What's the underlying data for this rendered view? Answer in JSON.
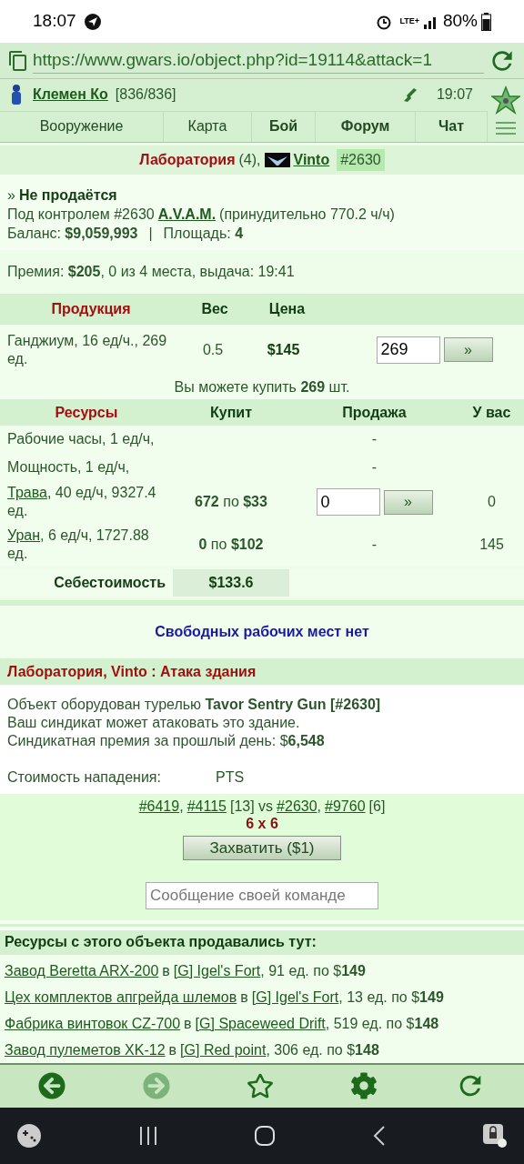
{
  "status_bar": {
    "time": "18:07",
    "network": "LTE+",
    "battery": "80%"
  },
  "address_bar": {
    "url": "https://www.gwars.io/object.php?id=19114&attack=1"
  },
  "player": {
    "name": "Клемен Ко",
    "hp": "[836/836]",
    "time": "19:07"
  },
  "nav": [
    {
      "label": "Вооружение",
      "bold": false
    },
    {
      "label": "Карта",
      "bold": false
    },
    {
      "label": "Бой",
      "bold": true
    },
    {
      "label": "Форум",
      "bold": true
    },
    {
      "label": "Чат",
      "bold": true
    }
  ],
  "title": {
    "name": "Лаборатория",
    "count": "(4),",
    "owner": "Vinto",
    "id": "#2630"
  },
  "info": {
    "marker": "»",
    "status": "Не продаётся",
    "control": "Под контролем #2630",
    "control_link": "A.V.A.M.",
    "control_note": "(принудительно 770.2 ч/ч)",
    "balance": "Баланс: **$9,059,993**",
    "separator": "|",
    "area": "Площадь: **4**",
    "premium": "Премия: **$205**, 0 из 4 места, выдача: 19:41"
  },
  "production": {
    "columns": [
      "Продукция",
      "Вес",
      "Цена"
    ],
    "rows": [
      {
        "name": "Ганджиум, 16 ед/ч., 269 ед.",
        "weight": "0.5",
        "price": "$145",
        "quantity": "269",
        "button": "»"
      }
    ],
    "note": "Вы можете купить **269** шт."
  },
  "resources": {
    "columns": [
      "Ресурсы",
      "Купит",
      "Продажа",
      "У вас"
    ],
    "rows": [
      {
        "kind": "plain",
        "name": "Рабочие часы, 1 ед/ч,",
        "sale": "-"
      },
      {
        "kind": "plain",
        "name": "Мощность, 1 ед/ч,",
        "sale": "-"
      },
      {
        "kind": "input",
        "link": "Трава",
        "name": ", 40 ед/ч, 9327.4 ед.",
        "buys": "**672** по **$33**",
        "quantity": "0",
        "button": "»",
        "have": "0"
      },
      {
        "kind": "plain",
        "link": "Уран",
        "name": ", 6 ед/ч, 1727.88 ед.",
        "buys": "**0** по **$102**",
        "sale": "-",
        "have": "145"
      }
    ],
    "cost_label": "Себестоимость",
    "cost_value": "$133.6"
  },
  "no_jobs": "Свободных рабочих мест нет",
  "attack": {
    "header": "Лаборатория, Vinto : Атака здания",
    "lines": [
      "Объект оборудован турелью **Tavor Sentry Gun [#2630]**",
      "Ваш синдикат может атаковать это здание.",
      "Синдикатная премия за прошлый день: $**6,548**"
    ],
    "cost_parts": [
      "Стоимость нападения:",
      "PTS"
    ],
    "teams": [
      {
        "kind": "comma",
        "link": "#6419",
        "after": ","
      },
      {
        "kind": "spaced",
        "link": "#4115",
        "after": "[13] vs"
      },
      {
        "kind": "comma",
        "link": "#2630",
        "after": ","
      },
      {
        "kind": "spaced",
        "link": "#9760",
        "after": "[6]"
      }
    ],
    "score": "6 x 6",
    "capture_button": "Захватить ($1)",
    "message_placeholder": "Сообщение своей команде"
  },
  "sold": {
    "header": "Ресурсы с этого объекта продавались тут:",
    "rows": [
      {
        "place": "Завод Beretta ARX-200",
        "in": "в",
        "location": "[G] Igel's Fort",
        "detail": ", 91 ед. по $**149**"
      },
      {
        "place": "Цех комплектов апгрейда шлемов",
        "in": "в",
        "location": "[G] Igel's Fort",
        "detail": ", 13 ед. по $**149**"
      },
      {
        "place": "Фабрика винтовок CZ-700",
        "in": "в",
        "location": "[G] Spaceweed Drift",
        "detail": ", 519 ед. по $**148**"
      },
      {
        "place": "Завод пулеметов XK-12",
        "in": "в",
        "location": "[G] Red point",
        "detail": ", 306 ед. по $**148**"
      }
    ]
  },
  "browser_toolbar": {
    "forward_enabled": false
  }
}
